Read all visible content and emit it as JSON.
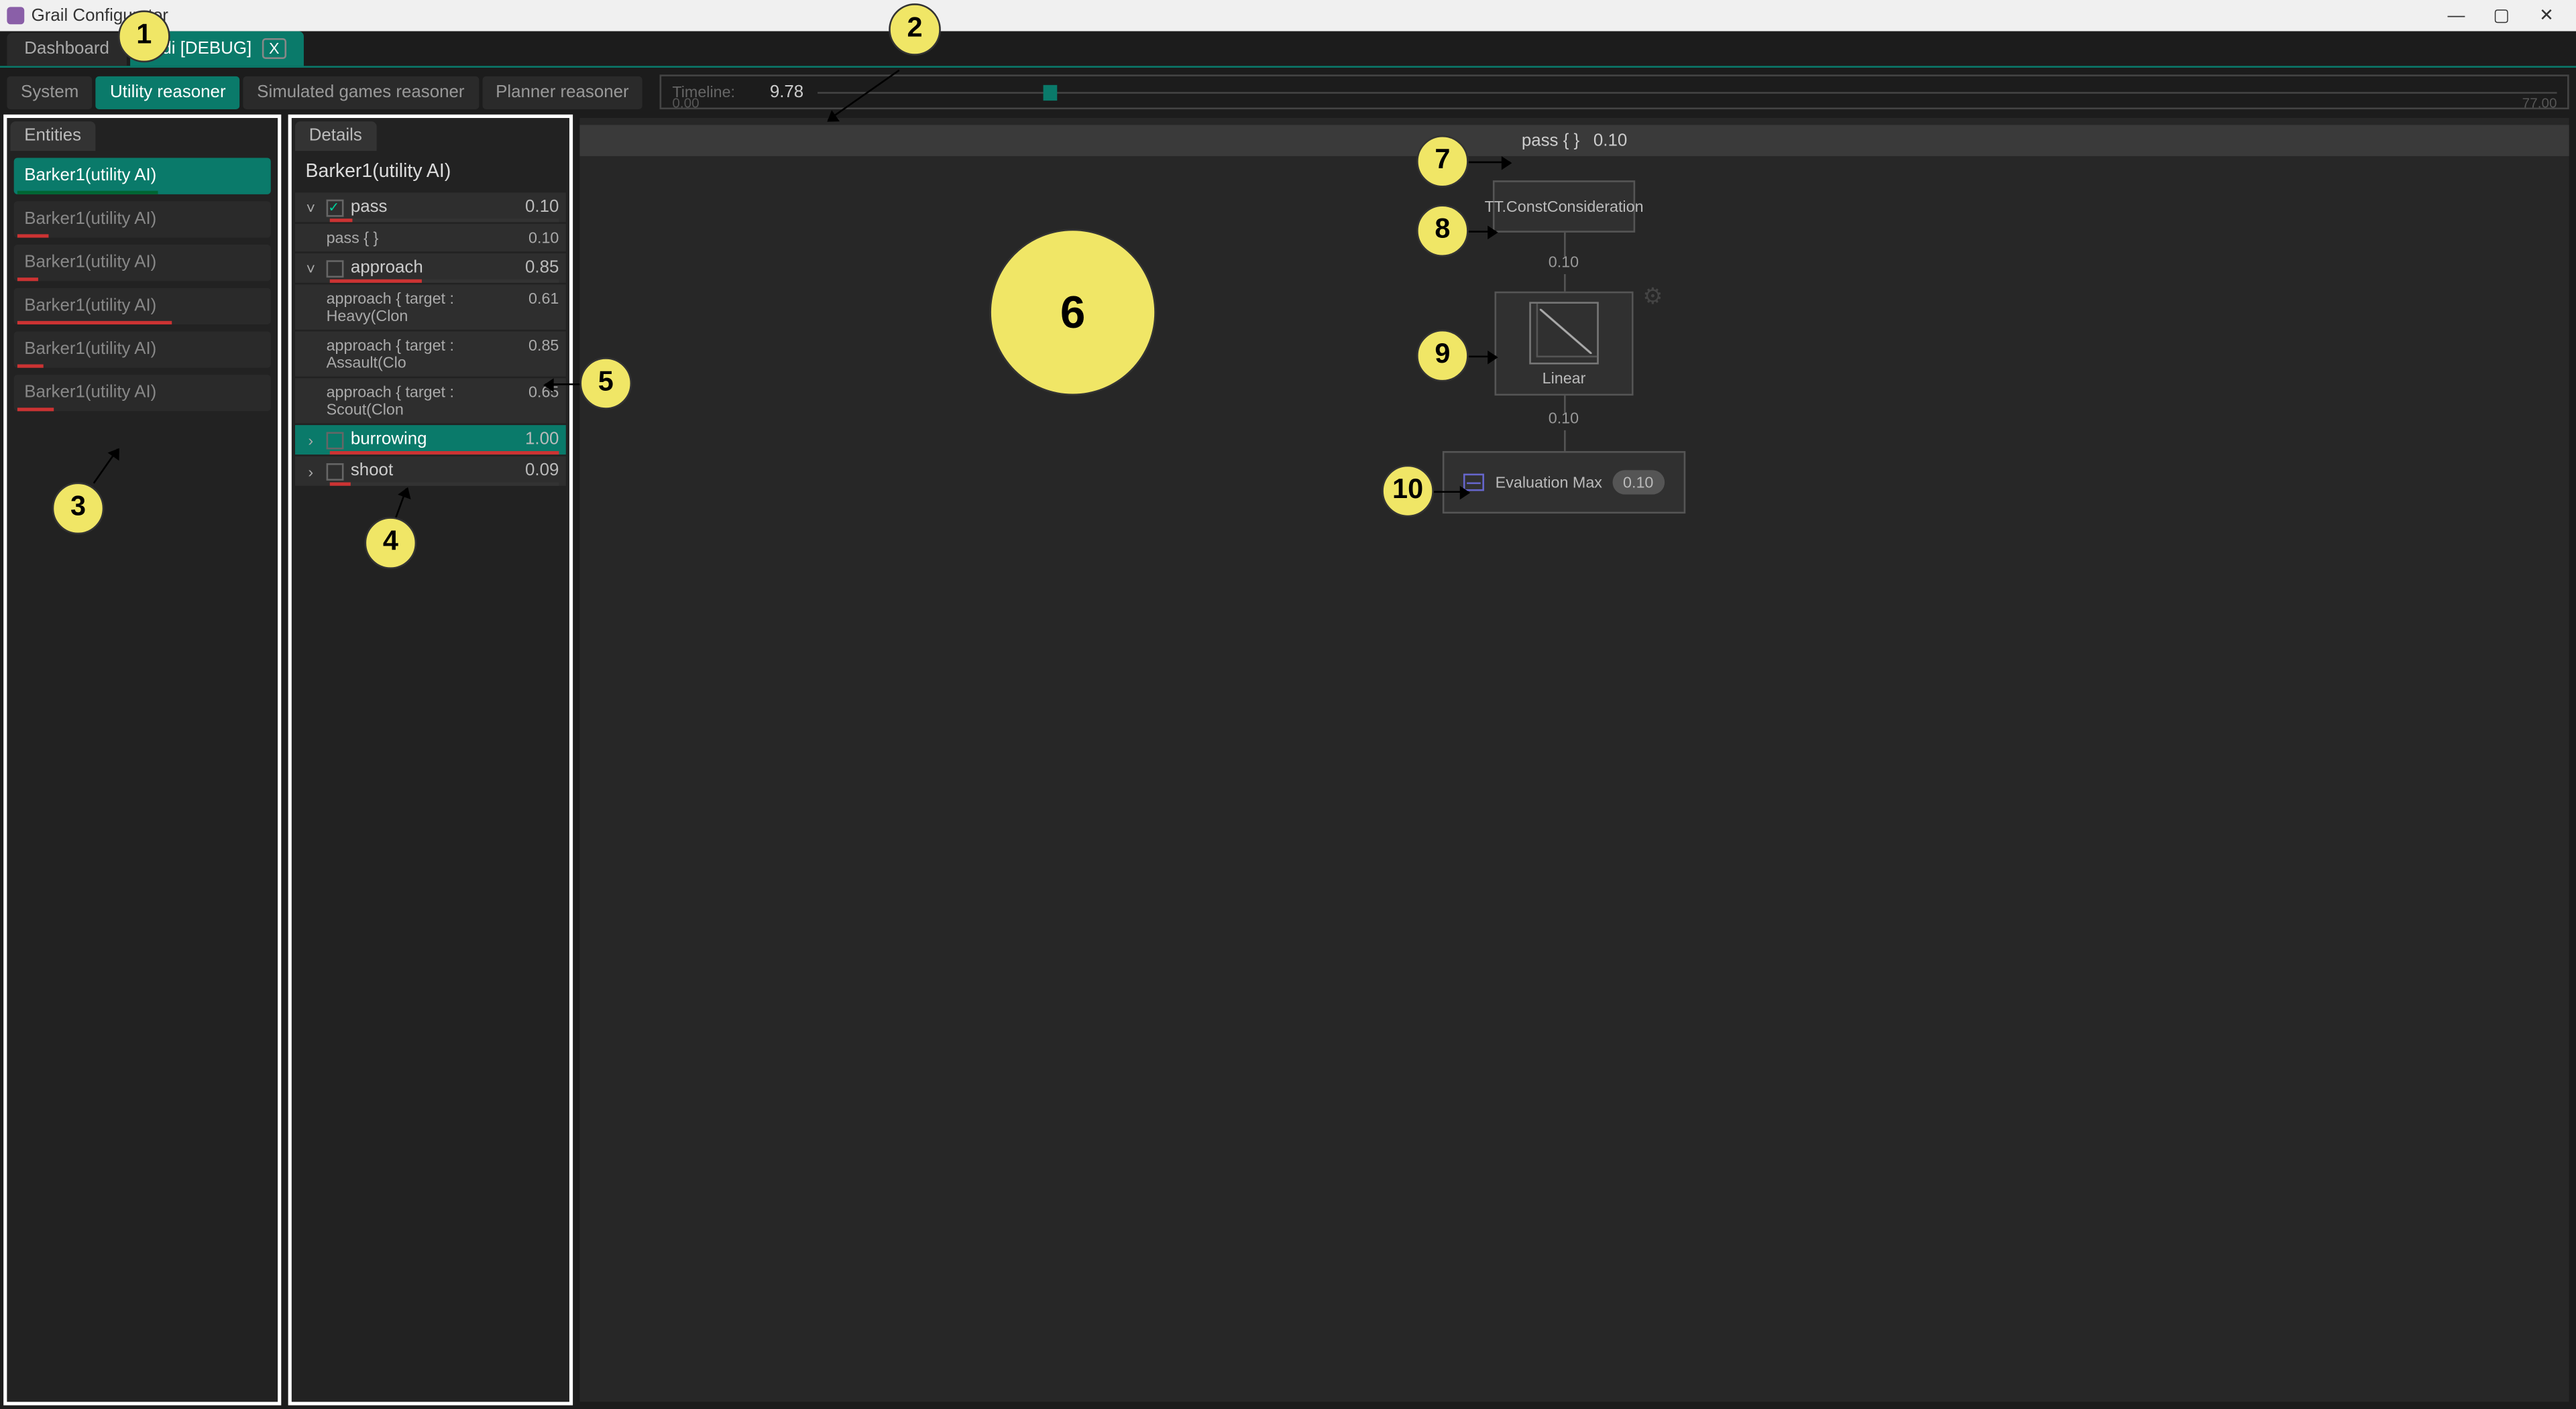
{
  "window": {
    "title": "Grail Configurator",
    "minimize": "—",
    "maximize": "▢",
    "close": "✕"
  },
  "topTabs": {
    "dashboard": "Dashboard",
    "debugFile": ".gdi [DEBUG]",
    "closeX": "X"
  },
  "subTabs": {
    "system": "System",
    "utility": "Utility reasoner",
    "simulated": "Simulated games reasoner",
    "planner": "Planner reasoner"
  },
  "timeline": {
    "label": "Timeline:",
    "value": "9.78",
    "min": "0.00",
    "max": "77.00"
  },
  "entitiesPanel": {
    "title": "Entities",
    "items": [
      {
        "label": "Barker1(utility AI)",
        "selected": true,
        "bar": 55
      },
      {
        "label": "Barker1(utility AI)",
        "selected": false,
        "bar": 12
      },
      {
        "label": "Barker1(utility AI)",
        "selected": false,
        "bar": 8
      },
      {
        "label": "Barker1(utility AI)",
        "selected": false,
        "bar": 60
      },
      {
        "label": "Barker1(utility AI)",
        "selected": false,
        "bar": 10
      },
      {
        "label": "Barker1(utility AI)",
        "selected": false,
        "bar": 14
      }
    ]
  },
  "detailsPanel": {
    "tab": "Details",
    "title": "Barker1(utility AI)",
    "behaviors": [
      {
        "type": "parent",
        "name": "pass",
        "val": "0.10",
        "expanded": true,
        "checked": true,
        "bar": 10
      },
      {
        "type": "child",
        "name": "pass { }",
        "val": "0.10"
      },
      {
        "type": "parent",
        "name": "approach",
        "val": "0.85",
        "expanded": true,
        "checked": false,
        "bar": 40
      },
      {
        "type": "child",
        "name": "approach { target : Heavy(Clon",
        "val": "0.61"
      },
      {
        "type": "child",
        "name": "approach { target : Assault(Clo",
        "val": "0.85"
      },
      {
        "type": "child",
        "name": "approach { target : Scout(Clon",
        "val": "0.65"
      },
      {
        "type": "parent",
        "name": "burrowing",
        "val": "1.00",
        "expanded": false,
        "checked": false,
        "bar": 100,
        "hl": true
      },
      {
        "type": "parent",
        "name": "shoot",
        "val": "0.09",
        "expanded": false,
        "checked": false,
        "bar": 9
      }
    ]
  },
  "tree": {
    "headerName": "pass { }",
    "headerVal": "0.10",
    "node1": "TT.ConstConsideration",
    "link1": "0.10",
    "node2": "Linear",
    "link2": "0.10",
    "node3": "Evaluation Max",
    "node3val": "0.10"
  },
  "callouts": {
    "c1": "1",
    "c2": "2",
    "c3": "3",
    "c4": "4",
    "c5": "5",
    "c6": "6",
    "c7": "7",
    "c8": "8",
    "c9": "9",
    "c10": "10"
  }
}
